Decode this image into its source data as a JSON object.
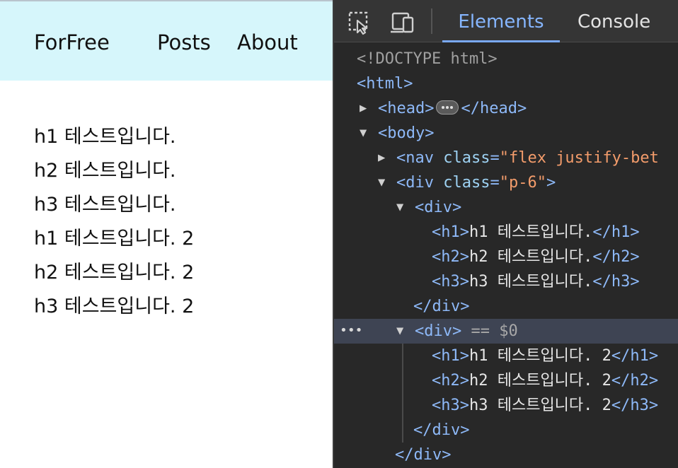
{
  "page": {
    "nav": {
      "brand": "ForFree",
      "links": [
        "Posts",
        "About"
      ]
    },
    "headings": [
      "h1 테스트입니다.",
      "h2 테스트입니다.",
      "h3 테스트입니다.",
      "h1 테스트입니다. 2",
      "h2 테스트입니다. 2",
      "h3 테스트입니다. 2"
    ]
  },
  "devtools": {
    "toolbar": {
      "icons": [
        "inspect-element-icon",
        "device-toolbar-icon"
      ],
      "tabs": [
        "Elements",
        "Console"
      ],
      "active_tab": "Elements"
    },
    "dom": {
      "doctype": "<!DOCTYPE html>",
      "html_open": "<html>",
      "head_open": "<head>",
      "head_close": "</head>",
      "body_open": "<body>",
      "nav_tag_open": "<nav",
      "nav_attr_name": "class",
      "nav_attr_value": "\"flex justify-bet",
      "div_tag_open": "<div",
      "div_attr_name": "class",
      "div_attr_value": "\"p-6\"",
      "div_tag_end": ">",
      "inner_div_open": "<div>",
      "inner_div_close": "</div>",
      "selected_marker": "== $0",
      "selected_dots": "•••",
      "outer_div_close": "</div>",
      "group1": [
        {
          "open": "<h1>",
          "text": "h1 테스트입니다.",
          "close": "</h1>"
        },
        {
          "open": "<h2>",
          "text": "h2 테스트입니다.",
          "close": "</h2>"
        },
        {
          "open": "<h3>",
          "text": "h3 테스트입니다.",
          "close": "</h3>"
        }
      ],
      "group2": [
        {
          "open": "<h1>",
          "text": "h1 테스트입니다. 2",
          "close": "</h1>"
        },
        {
          "open": "<h2>",
          "text": "h2 테스트입니다. 2",
          "close": "</h2>"
        },
        {
          "open": "<h3>",
          "text": "h3 테스트입니다. 2",
          "close": "</h3>"
        }
      ]
    }
  },
  "colors": {
    "nav_bg": "#d6f6fb",
    "devtools_bg": "#282828",
    "tag": "#8eb9f8",
    "attr_name": "#9ed2f3",
    "attr_value": "#f39c6b",
    "selection": "#3e4453",
    "active_tab": "#86b6ff"
  }
}
